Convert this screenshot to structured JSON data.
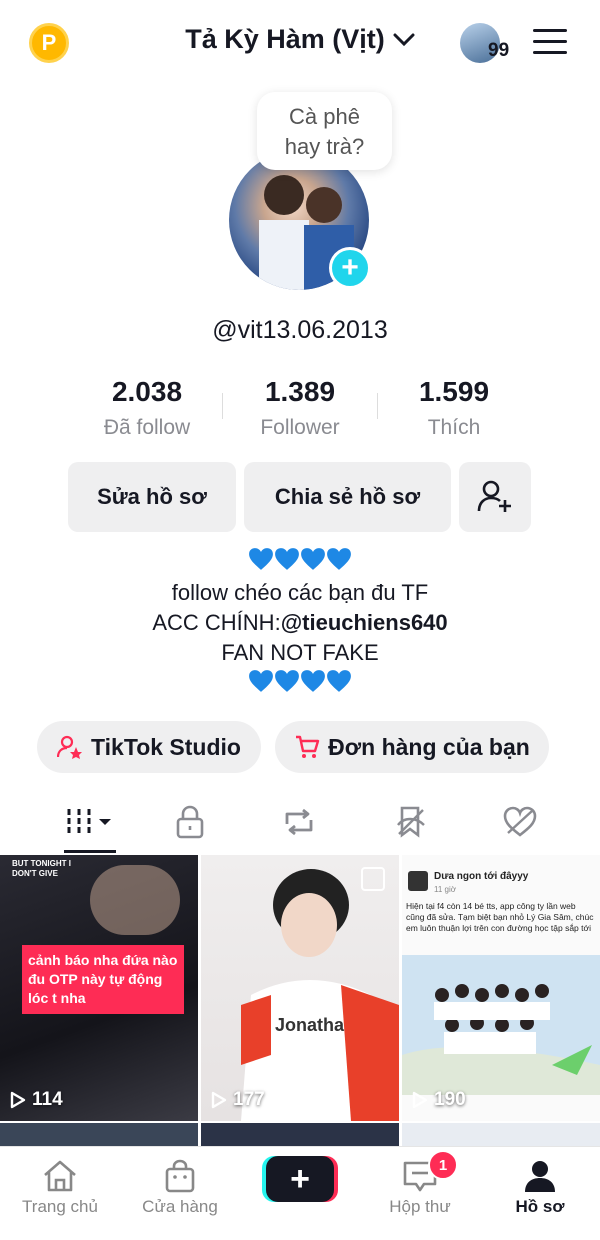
{
  "header": {
    "coin_symbol": "P",
    "display_name": "Tả Kỳ Hàm (Vịt)",
    "badge_count": "99"
  },
  "note": {
    "line1": "Cà phê",
    "line2": "hay trà?"
  },
  "profile": {
    "handle": "@vit13.06.2013",
    "stats": [
      {
        "value": "2.038",
        "label": "Đã follow"
      },
      {
        "value": "1.389",
        "label": "Follower"
      },
      {
        "value": "1.599",
        "label": "Thích"
      }
    ]
  },
  "actions": {
    "edit": "Sửa hồ sơ",
    "share": "Chia sẻ hồ sơ"
  },
  "bio": {
    "line1": "follow chéo các bạn đu TF",
    "line2_prefix": "ACC CHÍNH:",
    "line2_mention": "@tieuchiens640",
    "line3": "FAN NOT FAKE"
  },
  "pills": {
    "studio": "TikTok Studio",
    "orders": "Đơn hàng của bạn"
  },
  "videos": [
    {
      "views": "114",
      "caption": "cảnh báo nha đứa nào đu OTP này tự động lóc t nha",
      "top_text": "BUT TONIGHT I DON'T GIVE"
    },
    {
      "views": "177",
      "jersey_text": "Jonatha"
    },
    {
      "views": "190",
      "post_title": "Dưa ngon tới đâyyy",
      "post_time": "11 giờ",
      "post_body": "Hiện tại f4 còn 14 bé tts, app công ty lần web cũng đã sửa. Tạm biệt bạn nhỏ Lý Gia Sâm, chúc em luôn thuận lợi trên con đường học tập sắp tới"
    }
  ],
  "nav": {
    "home": "Trang chủ",
    "shop": "Cửa hàng",
    "inbox": "Hộp thư",
    "inbox_badge": "1",
    "profile": "Hồ sơ"
  },
  "colors": {
    "accent_pink": "#fe2c55",
    "accent_cyan": "#20d5ec",
    "coin": "#ffb800",
    "heart_blue": "#1e88e5"
  }
}
